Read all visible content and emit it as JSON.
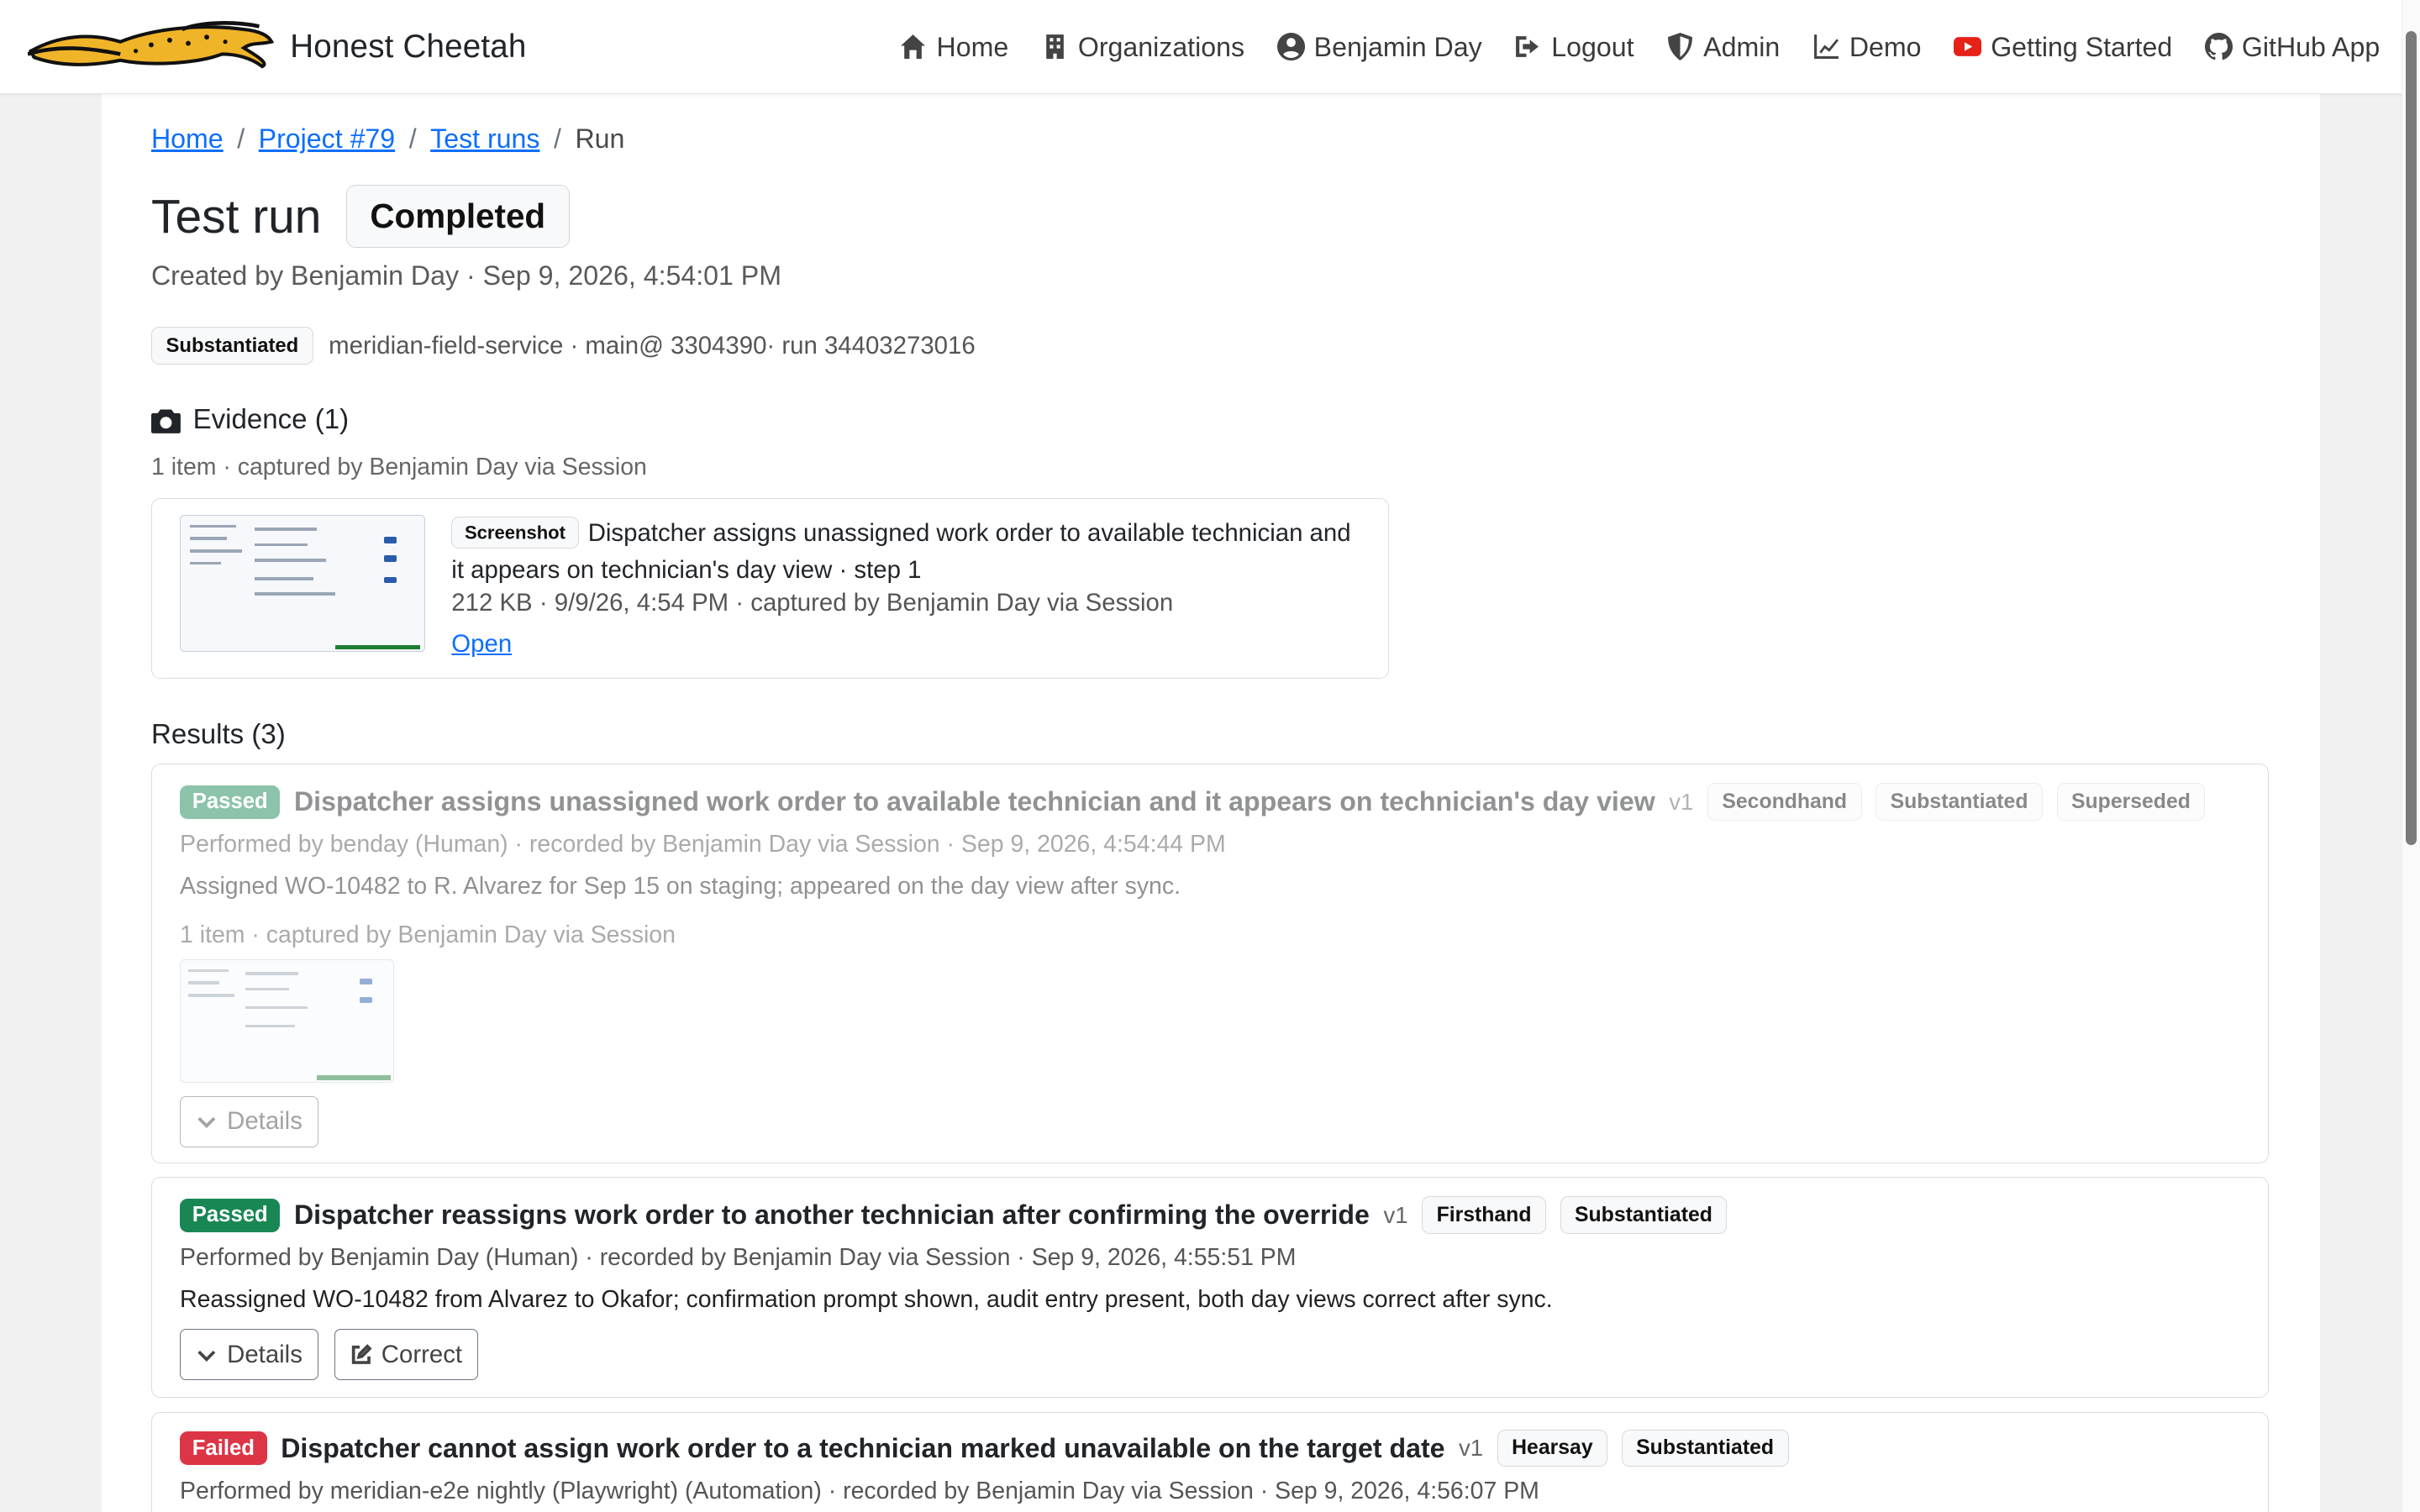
{
  "brand": {
    "name": "Honest Cheetah"
  },
  "nav": [
    {
      "label": "Home",
      "icon": "home-icon"
    },
    {
      "label": "Organizations",
      "icon": "building-icon"
    },
    {
      "label": "Benjamin Day",
      "icon": "user-circle-icon"
    },
    {
      "label": "Logout",
      "icon": "logout-icon"
    },
    {
      "label": "Admin",
      "icon": "shield-icon"
    },
    {
      "label": "Demo",
      "icon": "chart-line-icon"
    },
    {
      "label": "Getting Started",
      "icon": "youtube-icon"
    },
    {
      "label": "GitHub App",
      "icon": "github-icon"
    }
  ],
  "breadcrumb": {
    "home": "Home",
    "project": "Project #79",
    "runs": "Test runs",
    "current": "Run",
    "sep": "/"
  },
  "page": {
    "title": "Test run",
    "status": "Completed",
    "created": "Created by Benjamin Day · Sep 9, 2026, 4:54:01 PM",
    "meta_badge": "Substantiated",
    "meta_text": "meridian-field-service · main@ 3304390· run 34403273016"
  },
  "evidence": {
    "heading": "Evidence (1)",
    "summary": "1 item · captured by Benjamin Day via Session",
    "item": {
      "type": "Screenshot",
      "title": "Dispatcher assigns unassigned work order to available technician and it appears on technician's day view · step 1",
      "meta": "212 KB · 9/9/26, 4:54 PM · captured by Benjamin Day via Session",
      "open": "Open"
    }
  },
  "results": {
    "heading": "Results (3)",
    "items": [
      {
        "status": "Passed",
        "title": "Dispatcher assigns unassigned work order to available technician and it appears on technician's day view",
        "version": "v1",
        "tags": [
          "Secondhand",
          "Substantiated",
          "Superseded"
        ],
        "performed": "Performed by benday (Human) · recorded by Benjamin Day via Session · Sep 9, 2026, 4:54:44 PM",
        "note": "Assigned WO-10482 to R. Alvarez for Sep 15 on staging; appeared on the day view after sync.",
        "evidence": "1 item · captured by Benjamin Day via Session",
        "details": "Details"
      },
      {
        "status": "Passed",
        "title": "Dispatcher reassigns work order to another technician after confirming the override",
        "version": "v1",
        "tags": [
          "Firsthand",
          "Substantiated"
        ],
        "performed": "Performed by Benjamin Day (Human) · recorded by Benjamin Day via Session · Sep 9, 2026, 4:55:51 PM",
        "note": "Reassigned WO-10482 from Alvarez to Okafor; confirmation prompt shown, audit entry present, both day views correct after sync.",
        "details": "Details",
        "correct": "Correct"
      },
      {
        "status": "Failed",
        "title": "Dispatcher cannot assign work order to a technician marked unavailable on the target date",
        "version": "v1",
        "tags": [
          "Hearsay",
          "Substantiated"
        ],
        "performed": "Performed by meridian-e2e nightly (Playwright) (Automation) · recorded by Benjamin Day via Session · Sep 9, 2026, 4:56:07 PM"
      }
    ]
  },
  "colors": {
    "link": "#0d6efd",
    "passed": "#198754",
    "failed": "#dc3545",
    "cheetah": "#f0b429"
  }
}
